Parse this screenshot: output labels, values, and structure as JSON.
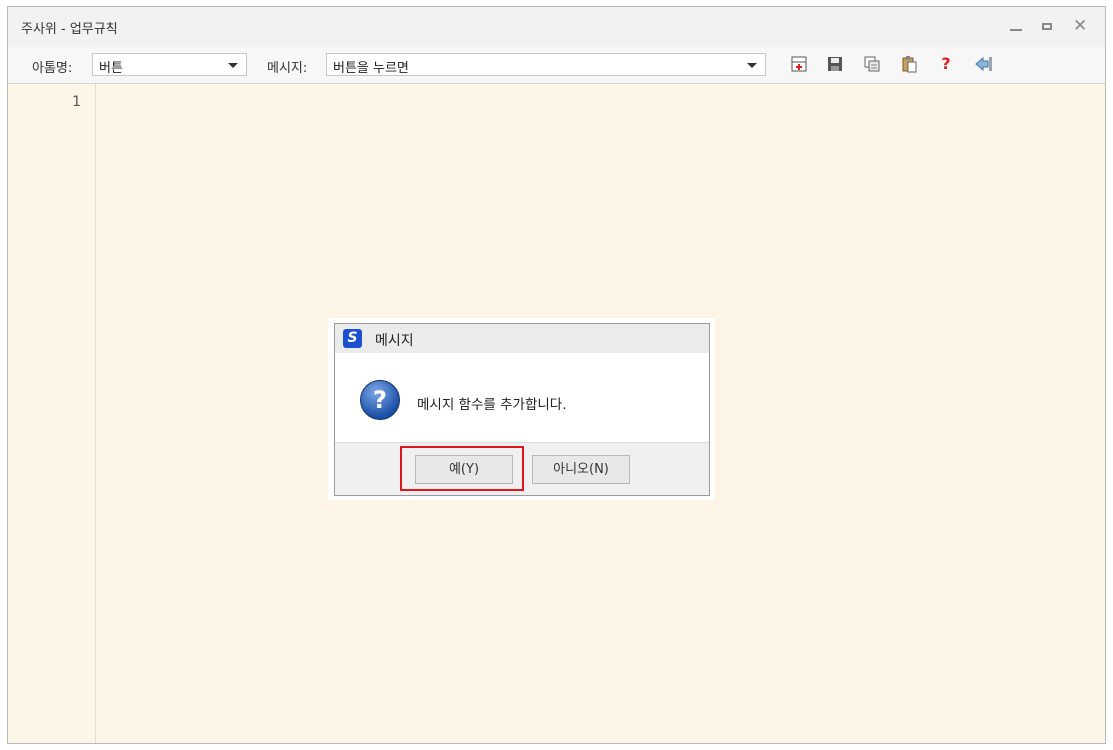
{
  "window": {
    "title": "주사위 - 업무규칙",
    "controls": {
      "minimize_icon": "minimize-icon",
      "maximize_icon": "maximize-icon",
      "close_icon": "close-icon",
      "close_glyph": "✕"
    }
  },
  "toolbar": {
    "object_label": "아톰명:",
    "object_value": "버튼",
    "message_label": "메시지:",
    "message_value": "버튼을 누르면",
    "icons": [
      "insert-icon",
      "save-icon",
      "copy-icon",
      "paste-icon",
      "help-icon",
      "exit-icon"
    ],
    "help_glyph": "?"
  },
  "editor": {
    "line_numbers": [
      "1"
    ],
    "background": "#fdf5e6"
  },
  "dialog": {
    "title": "메시지",
    "logo_letter": "S",
    "icon": "question-icon",
    "icon_glyph": "?",
    "message": "메시지 함수를 추가합니다.",
    "yes_label": "예(Y)",
    "no_label": "아니오(N)"
  },
  "colors": {
    "highlight": "#e0161d",
    "logo": "#1d4fd1",
    "help": "#e02020"
  }
}
